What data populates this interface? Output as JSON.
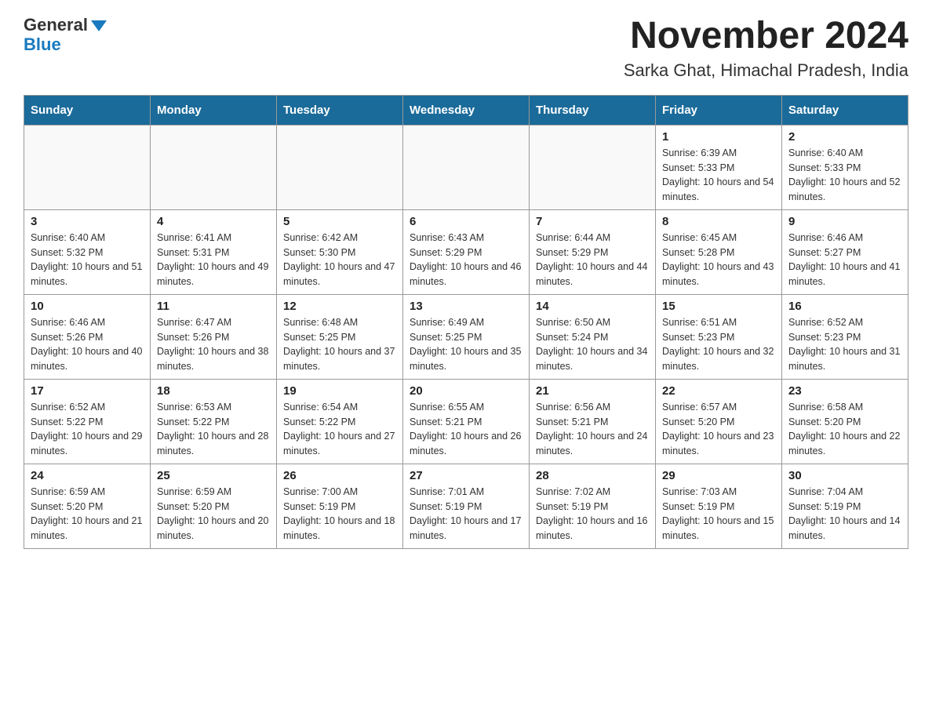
{
  "logo": {
    "general": "General",
    "blue": "Blue"
  },
  "title": "November 2024",
  "subtitle": "Sarka Ghat, Himachal Pradesh, India",
  "weekdays": [
    "Sunday",
    "Monday",
    "Tuesday",
    "Wednesday",
    "Thursday",
    "Friday",
    "Saturday"
  ],
  "weeks": [
    [
      {
        "day": "",
        "sunrise": "",
        "sunset": "",
        "daylight": ""
      },
      {
        "day": "",
        "sunrise": "",
        "sunset": "",
        "daylight": ""
      },
      {
        "day": "",
        "sunrise": "",
        "sunset": "",
        "daylight": ""
      },
      {
        "day": "",
        "sunrise": "",
        "sunset": "",
        "daylight": ""
      },
      {
        "day": "",
        "sunrise": "",
        "sunset": "",
        "daylight": ""
      },
      {
        "day": "1",
        "sunrise": "Sunrise: 6:39 AM",
        "sunset": "Sunset: 5:33 PM",
        "daylight": "Daylight: 10 hours and 54 minutes."
      },
      {
        "day": "2",
        "sunrise": "Sunrise: 6:40 AM",
        "sunset": "Sunset: 5:33 PM",
        "daylight": "Daylight: 10 hours and 52 minutes."
      }
    ],
    [
      {
        "day": "3",
        "sunrise": "Sunrise: 6:40 AM",
        "sunset": "Sunset: 5:32 PM",
        "daylight": "Daylight: 10 hours and 51 minutes."
      },
      {
        "day": "4",
        "sunrise": "Sunrise: 6:41 AM",
        "sunset": "Sunset: 5:31 PM",
        "daylight": "Daylight: 10 hours and 49 minutes."
      },
      {
        "day": "5",
        "sunrise": "Sunrise: 6:42 AM",
        "sunset": "Sunset: 5:30 PM",
        "daylight": "Daylight: 10 hours and 47 minutes."
      },
      {
        "day": "6",
        "sunrise": "Sunrise: 6:43 AM",
        "sunset": "Sunset: 5:29 PM",
        "daylight": "Daylight: 10 hours and 46 minutes."
      },
      {
        "day": "7",
        "sunrise": "Sunrise: 6:44 AM",
        "sunset": "Sunset: 5:29 PM",
        "daylight": "Daylight: 10 hours and 44 minutes."
      },
      {
        "day": "8",
        "sunrise": "Sunrise: 6:45 AM",
        "sunset": "Sunset: 5:28 PM",
        "daylight": "Daylight: 10 hours and 43 minutes."
      },
      {
        "day": "9",
        "sunrise": "Sunrise: 6:46 AM",
        "sunset": "Sunset: 5:27 PM",
        "daylight": "Daylight: 10 hours and 41 minutes."
      }
    ],
    [
      {
        "day": "10",
        "sunrise": "Sunrise: 6:46 AM",
        "sunset": "Sunset: 5:26 PM",
        "daylight": "Daylight: 10 hours and 40 minutes."
      },
      {
        "day": "11",
        "sunrise": "Sunrise: 6:47 AM",
        "sunset": "Sunset: 5:26 PM",
        "daylight": "Daylight: 10 hours and 38 minutes."
      },
      {
        "day": "12",
        "sunrise": "Sunrise: 6:48 AM",
        "sunset": "Sunset: 5:25 PM",
        "daylight": "Daylight: 10 hours and 37 minutes."
      },
      {
        "day": "13",
        "sunrise": "Sunrise: 6:49 AM",
        "sunset": "Sunset: 5:25 PM",
        "daylight": "Daylight: 10 hours and 35 minutes."
      },
      {
        "day": "14",
        "sunrise": "Sunrise: 6:50 AM",
        "sunset": "Sunset: 5:24 PM",
        "daylight": "Daylight: 10 hours and 34 minutes."
      },
      {
        "day": "15",
        "sunrise": "Sunrise: 6:51 AM",
        "sunset": "Sunset: 5:23 PM",
        "daylight": "Daylight: 10 hours and 32 minutes."
      },
      {
        "day": "16",
        "sunrise": "Sunrise: 6:52 AM",
        "sunset": "Sunset: 5:23 PM",
        "daylight": "Daylight: 10 hours and 31 minutes."
      }
    ],
    [
      {
        "day": "17",
        "sunrise": "Sunrise: 6:52 AM",
        "sunset": "Sunset: 5:22 PM",
        "daylight": "Daylight: 10 hours and 29 minutes."
      },
      {
        "day": "18",
        "sunrise": "Sunrise: 6:53 AM",
        "sunset": "Sunset: 5:22 PM",
        "daylight": "Daylight: 10 hours and 28 minutes."
      },
      {
        "day": "19",
        "sunrise": "Sunrise: 6:54 AM",
        "sunset": "Sunset: 5:22 PM",
        "daylight": "Daylight: 10 hours and 27 minutes."
      },
      {
        "day": "20",
        "sunrise": "Sunrise: 6:55 AM",
        "sunset": "Sunset: 5:21 PM",
        "daylight": "Daylight: 10 hours and 26 minutes."
      },
      {
        "day": "21",
        "sunrise": "Sunrise: 6:56 AM",
        "sunset": "Sunset: 5:21 PM",
        "daylight": "Daylight: 10 hours and 24 minutes."
      },
      {
        "day": "22",
        "sunrise": "Sunrise: 6:57 AM",
        "sunset": "Sunset: 5:20 PM",
        "daylight": "Daylight: 10 hours and 23 minutes."
      },
      {
        "day": "23",
        "sunrise": "Sunrise: 6:58 AM",
        "sunset": "Sunset: 5:20 PM",
        "daylight": "Daylight: 10 hours and 22 minutes."
      }
    ],
    [
      {
        "day": "24",
        "sunrise": "Sunrise: 6:59 AM",
        "sunset": "Sunset: 5:20 PM",
        "daylight": "Daylight: 10 hours and 21 minutes."
      },
      {
        "day": "25",
        "sunrise": "Sunrise: 6:59 AM",
        "sunset": "Sunset: 5:20 PM",
        "daylight": "Daylight: 10 hours and 20 minutes."
      },
      {
        "day": "26",
        "sunrise": "Sunrise: 7:00 AM",
        "sunset": "Sunset: 5:19 PM",
        "daylight": "Daylight: 10 hours and 18 minutes."
      },
      {
        "day": "27",
        "sunrise": "Sunrise: 7:01 AM",
        "sunset": "Sunset: 5:19 PM",
        "daylight": "Daylight: 10 hours and 17 minutes."
      },
      {
        "day": "28",
        "sunrise": "Sunrise: 7:02 AM",
        "sunset": "Sunset: 5:19 PM",
        "daylight": "Daylight: 10 hours and 16 minutes."
      },
      {
        "day": "29",
        "sunrise": "Sunrise: 7:03 AM",
        "sunset": "Sunset: 5:19 PM",
        "daylight": "Daylight: 10 hours and 15 minutes."
      },
      {
        "day": "30",
        "sunrise": "Sunrise: 7:04 AM",
        "sunset": "Sunset: 5:19 PM",
        "daylight": "Daylight: 10 hours and 14 minutes."
      }
    ]
  ]
}
